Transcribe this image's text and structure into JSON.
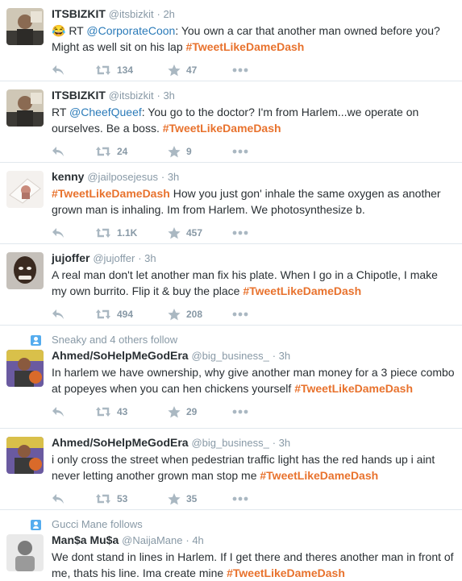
{
  "tweets": [
    {
      "context": "",
      "fullname": "ITSBIZKIT",
      "username": "@itsbizkit",
      "time": "· 2h",
      "parts": [
        {
          "t": "text",
          "v": "😂 RT "
        },
        {
          "t": "mention",
          "v": "@CorporateCoon"
        },
        {
          "t": "text",
          "v": ": You own a car that another man owned before you? Might as well sit on his lap "
        },
        {
          "t": "hashtag",
          "v": "#TweetLikeDameDash"
        }
      ],
      "retweets": "134",
      "favorites": "47",
      "avatar": "bizkit"
    },
    {
      "context": "",
      "fullname": "ITSBIZKIT",
      "username": "@itsbizkit",
      "time": "· 3h",
      "parts": [
        {
          "t": "text",
          "v": "RT "
        },
        {
          "t": "mention",
          "v": "@CheefQueef"
        },
        {
          "t": "text",
          "v": ": You go to the doctor? I'm from Harlem...we operate on ourselves. Be a boss. "
        },
        {
          "t": "hashtag",
          "v": "#TweetLikeDameDash"
        }
      ],
      "retweets": "24",
      "favorites": "9",
      "avatar": "bizkit"
    },
    {
      "context": "",
      "fullname": "kenny",
      "username": "@jailposejesus",
      "time": "· 3h",
      "parts": [
        {
          "t": "hashtag",
          "v": "#TweetLikeDameDash"
        },
        {
          "t": "text",
          "v": " How you just gon' inhale the same oxygen as another grown man is inhaling. Im from Harlem. We photosynthesize b."
        }
      ],
      "retweets": "1.1K",
      "favorites": "457",
      "avatar": "kenny"
    },
    {
      "context": "",
      "fullname": "jujoffer",
      "username": "@jujoffer",
      "time": "· 3h",
      "parts": [
        {
          "t": "text",
          "v": "A real man don't let another man fix his plate. When I go in a Chipotle, I make my own burrito. Flip it & buy the place "
        },
        {
          "t": "hashtag",
          "v": "#TweetLikeDameDash"
        }
      ],
      "retweets": "494",
      "favorites": "208",
      "avatar": "jujoffer"
    },
    {
      "context": "Sneaky and 4 others follow",
      "fullname": "Ahmed/SoHelpMeGodEra",
      "username": "@big_business_",
      "time": "· 3h",
      "parts": [
        {
          "t": "text",
          "v": "In harlem we have ownership, why give another man money for a 3 piece combo at popeyes when you can hen chickens yourself "
        },
        {
          "t": "hashtag",
          "v": "#TweetLikeDameDash"
        }
      ],
      "retweets": "43",
      "favorites": "29",
      "avatar": "ahmed"
    },
    {
      "context": "",
      "fullname": "Ahmed/SoHelpMeGodEra",
      "username": "@big_business_",
      "time": "· 3h",
      "parts": [
        {
          "t": "text",
          "v": "i only cross the street when pedestrian traffic light has the red hands up i aint never letting another grown man stop me "
        },
        {
          "t": "hashtag",
          "v": "#TweetLikeDameDash"
        }
      ],
      "retweets": "53",
      "favorites": "35",
      "avatar": "ahmed"
    },
    {
      "context": "Gucci Mane follows",
      "fullname": "Man$a Mu$a",
      "username": "@NaijaMane",
      "time": "· 4h",
      "parts": [
        {
          "t": "text",
          "v": "We dont stand in lines in Harlem. If I get there and theres another man in front of me, thats his line. Ima create mine "
        },
        {
          "t": "hashtag",
          "v": "#TweetLikeDameDash"
        }
      ],
      "retweets": "",
      "favorites": "",
      "avatar": "mansa"
    }
  ],
  "colors": {
    "hashtag": "#e8722d",
    "mention": "#2b7bb9",
    "meta": "#8899a6",
    "action_icon": "#aab8c2",
    "context_icon": "#55acee"
  },
  "icons": {
    "reply": "reply-icon",
    "retweet": "retweet-icon",
    "favorite": "star-icon",
    "more": "more-icon",
    "context": "follow-context-icon"
  }
}
